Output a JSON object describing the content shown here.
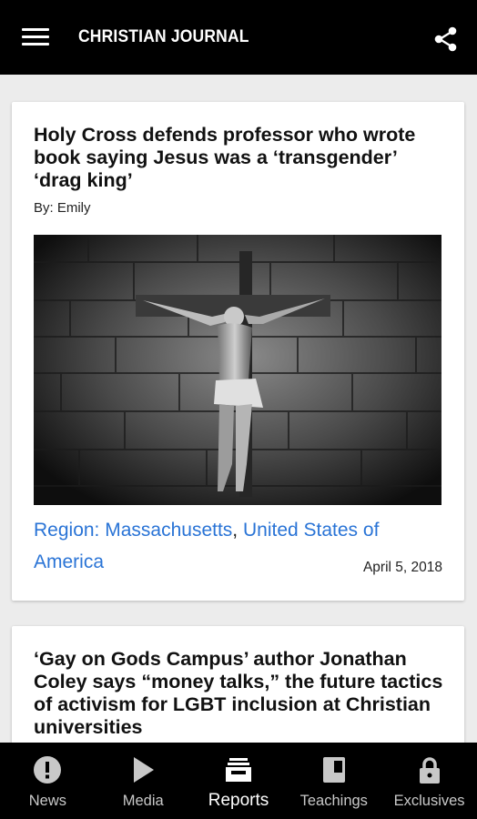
{
  "app": {
    "title": "CHRISTIAN JOURNAL"
  },
  "articles": [
    {
      "headline": "Holy Cross defends professor who wrote book saying Jesus was a ‘transgender’ ‘drag king’",
      "byline": "By: Emily",
      "image_icon": "crucifix-photo",
      "region_label": "Region:",
      "region_link_1": "Massachusetts",
      "region_separator": ",",
      "region_link_2": "United States of America",
      "date": "April 5, 2018"
    },
    {
      "headline": "‘Gay on Gods Campus’ author Jonathan Coley says “money talks,” the future tactics of activism for LGBT inclusion at Christian universities"
    }
  ],
  "nav": [
    {
      "label": "News",
      "icon": "alert-circle-icon",
      "active": false
    },
    {
      "label": "Media",
      "icon": "play-icon",
      "active": false
    },
    {
      "label": "Reports",
      "icon": "inbox-stack-icon",
      "active": true
    },
    {
      "label": "Teachings",
      "icon": "book-icon",
      "active": false
    },
    {
      "label": "Exclusives",
      "icon": "lock-icon",
      "active": false
    }
  ],
  "colors": {
    "appbar": "#000000",
    "link": "#2a74d6",
    "background": "#ececec"
  }
}
